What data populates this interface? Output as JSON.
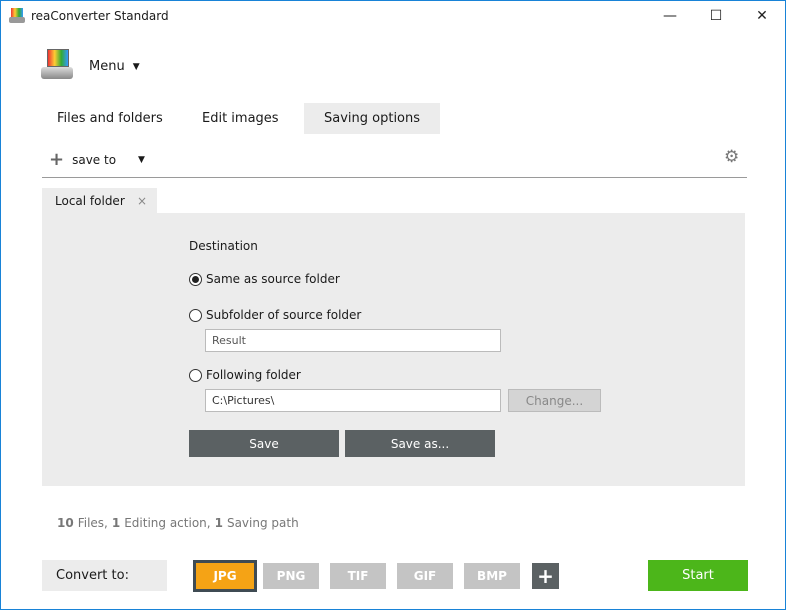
{
  "window": {
    "title": "reaConverter Standard",
    "minimize": "—",
    "maximize": "☐",
    "close": "✕"
  },
  "menu": {
    "label": "Menu"
  },
  "tabs": [
    {
      "label": "Files and folders"
    },
    {
      "label": "Edit images"
    },
    {
      "label": "Saving options"
    }
  ],
  "toolbar": {
    "save_to": "save to"
  },
  "panel_tab": {
    "label": "Local folder",
    "close": "×"
  },
  "destination": {
    "heading": "Destination",
    "options": [
      {
        "label": "Same as source folder",
        "selected": true
      },
      {
        "label": "Subfolder of source folder",
        "selected": false
      },
      {
        "label": "Following folder",
        "selected": false
      }
    ],
    "subfolder_value": "Result",
    "folder_value": "C:\\Pictures\\",
    "change_label": "Change...",
    "save_label": "Save",
    "save_as_label": "Save as..."
  },
  "status": {
    "files_count": "10",
    "files_label": "Files,",
    "edit_count": "1",
    "edit_label": "Editing action,",
    "path_count": "1",
    "path_label": "Saving path"
  },
  "convert": {
    "label": "Convert to:",
    "formats": [
      "JPG",
      "PNG",
      "TIF",
      "GIF",
      "BMP"
    ],
    "selected": "JPG",
    "add": "+",
    "start": "Start"
  },
  "colors": {
    "accent": "#f5a315",
    "start": "#4cb61a",
    "dark": "#5b6163"
  }
}
